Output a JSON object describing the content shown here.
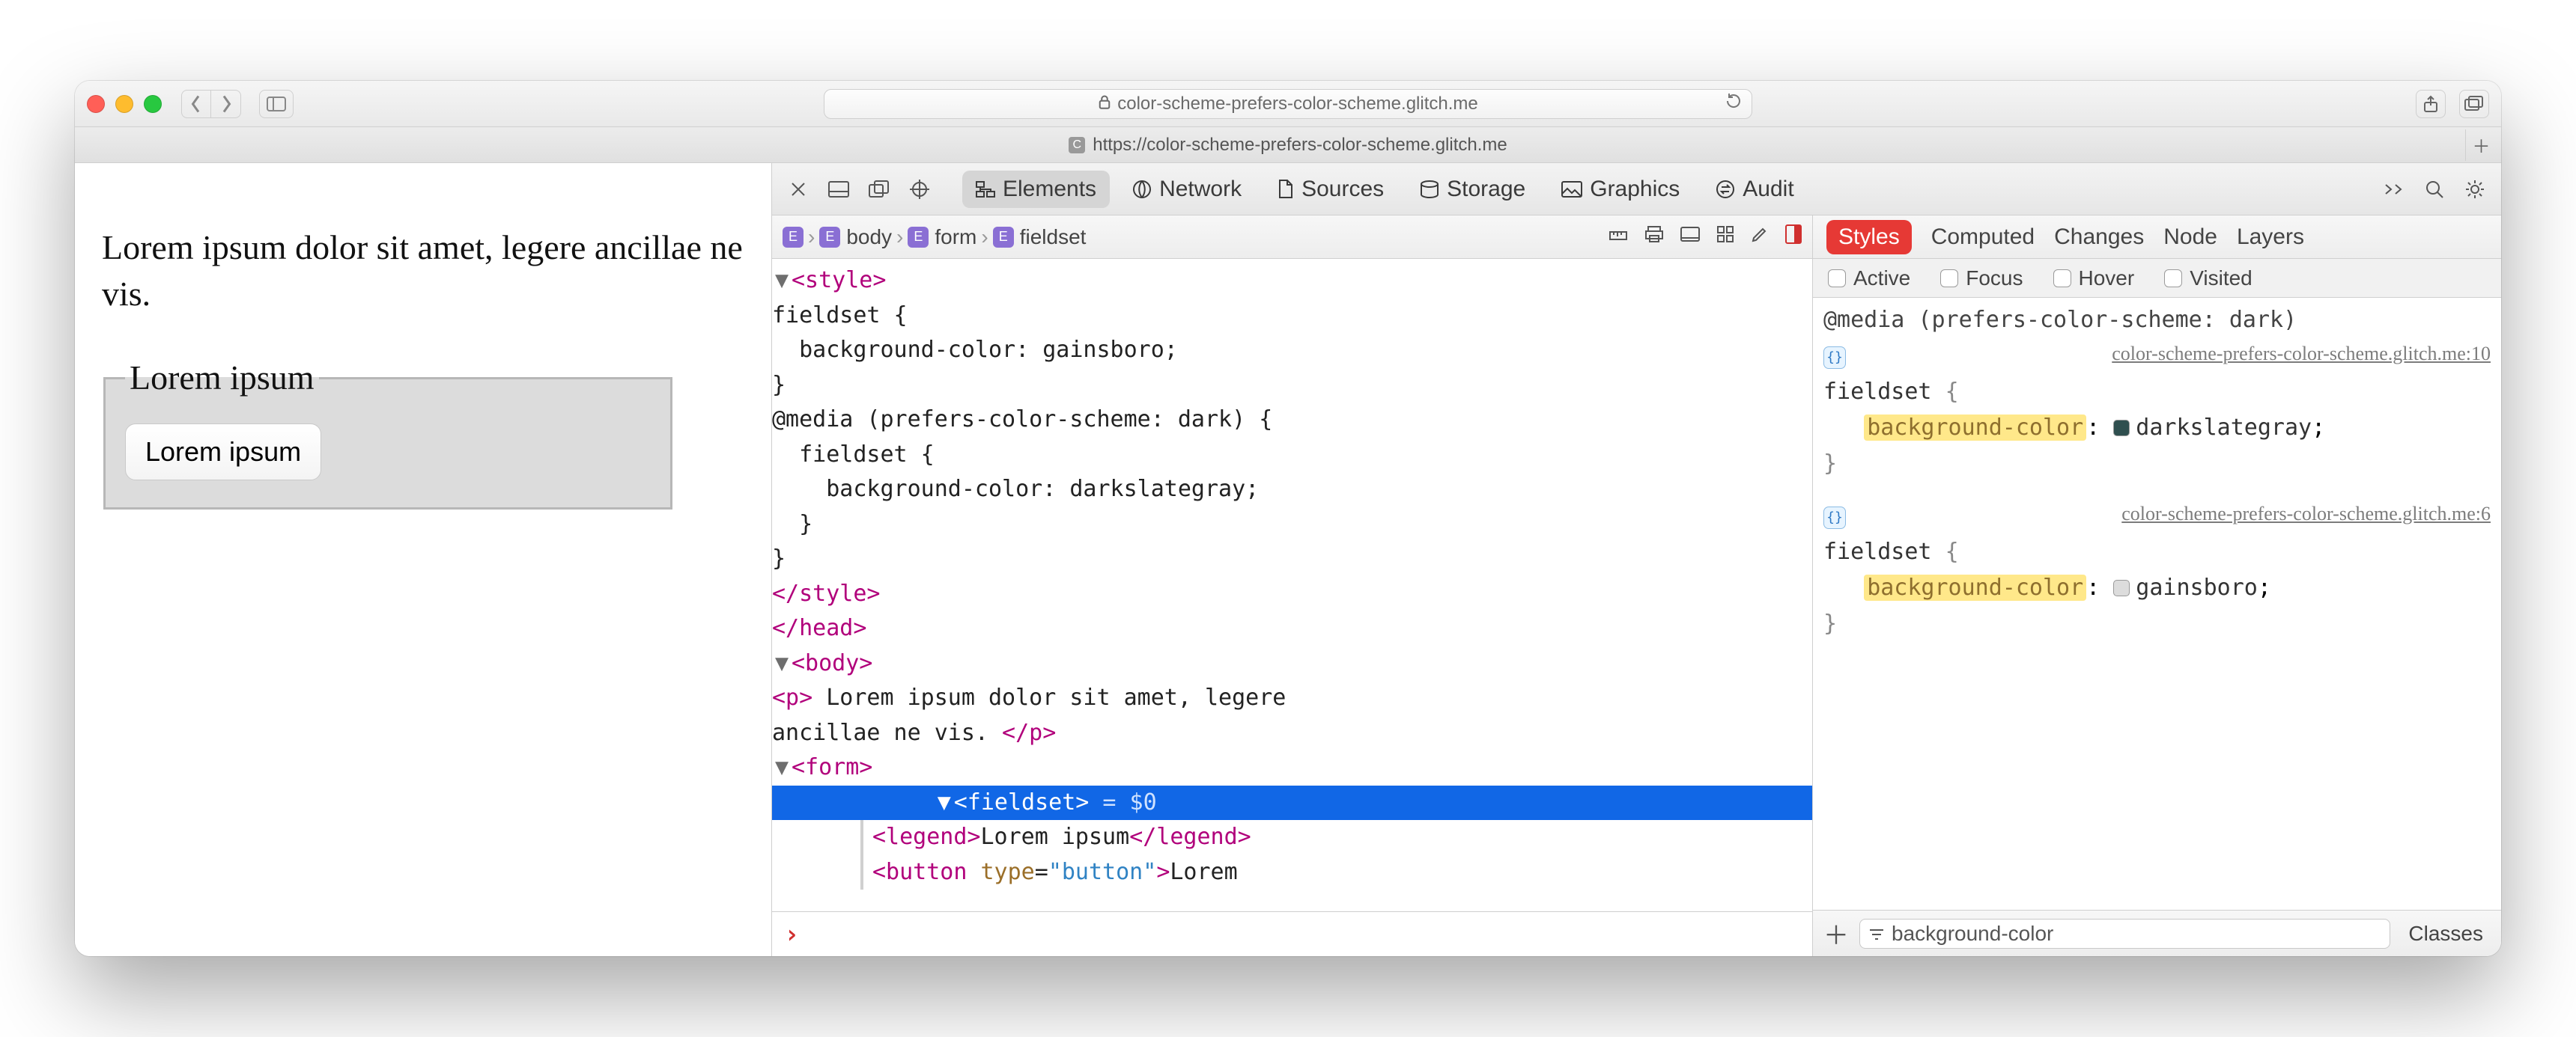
{
  "titlebar": {
    "url_host": "color-scheme-prefers-color-scheme.glitch.me"
  },
  "tabbar": {
    "title": "https://color-scheme-prefers-color-scheme.glitch.me",
    "favicon_letter": "C"
  },
  "page": {
    "paragraph": "Lorem ipsum dolor sit amet, legere ancillae ne vis.",
    "legend": "Lorem ipsum",
    "button": "Lorem ipsum"
  },
  "devtools": {
    "tabs": [
      "Elements",
      "Network",
      "Sources",
      "Storage",
      "Graphics",
      "Audit"
    ],
    "active_tab": "Elements",
    "breadcrumb": [
      "body",
      "form",
      "fieldset"
    ],
    "dom": {
      "style_open": "<style>",
      "css1a": "fieldset {",
      "css1b": "  background-color: gainsboro;",
      "css1c": "}",
      "css2a": "@media (prefers-color-scheme: dark) {",
      "css2b": "  fieldset {",
      "css2c": "    background-color: darkslategray;",
      "css2d": "  }",
      "css2e": "}",
      "style_close": "</style>",
      "head_close": "</head>",
      "body_open": "<body>",
      "p_open": "<p>",
      "p_text": " Lorem ipsum dolor sit amet, legere ancillae ne vis. ",
      "p_close": "</p>",
      "form_open": "<form>",
      "fieldset_open": "<fieldset>",
      "fieldset_suffix": " = $0",
      "legend_tag_open": "<legend>",
      "legend_text": "Lorem ipsum",
      "legend_tag_close": "</legend>",
      "button_open_a": "<button ",
      "button_attr_name": "type",
      "button_attr_val": "\"button\"",
      "button_open_b": ">",
      "button_text": "Lorem"
    },
    "styles": {
      "tabs": [
        "Styles",
        "Computed",
        "Changes",
        "Node",
        "Layers"
      ],
      "active_tab": "Styles",
      "pseudo": [
        "Active",
        "Focus",
        "Hover",
        "Visited"
      ],
      "rules": [
        {
          "media": "@media (prefers-color-scheme: dark)",
          "source": "color-scheme-prefers-color-scheme.glitch.me:10",
          "selector": "fieldset",
          "prop": "background-color",
          "value": "darkslategray",
          "swatch": "#2f4f4f"
        },
        {
          "media": "",
          "source": "color-scheme-prefers-color-scheme.glitch.me:6",
          "selector": "fieldset",
          "prop": "background-color",
          "value": "gainsboro",
          "swatch": "#dcdcdc"
        }
      ],
      "filter_value": "background-color",
      "classes_label": "Classes"
    }
  }
}
